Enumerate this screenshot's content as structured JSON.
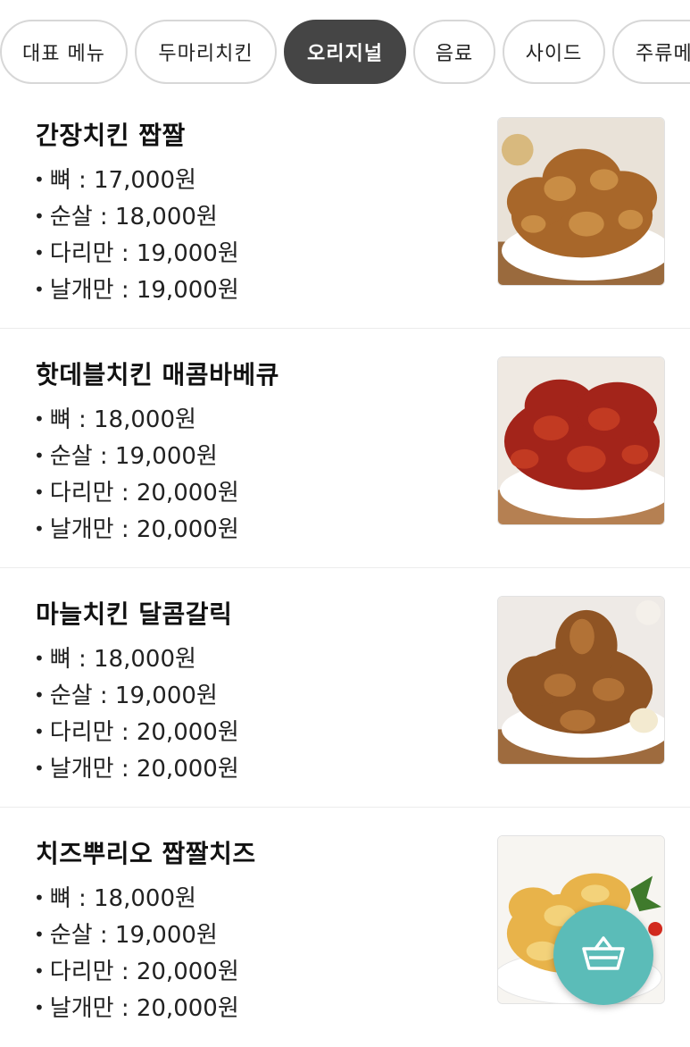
{
  "tabs": [
    {
      "label": "대표 메뉴",
      "active": false
    },
    {
      "label": "두마리치킨",
      "active": false
    },
    {
      "label": "오리지널",
      "active": true
    },
    {
      "label": "음료",
      "active": false
    },
    {
      "label": "사이드",
      "active": false
    },
    {
      "label": "주류메뉴",
      "active": false
    }
  ],
  "menu": [
    {
      "name": "간장치킨 짭짤",
      "prices": [
        "뼈 : 17,000원",
        "순살 : 18,000원",
        "다리만 : 19,000원",
        "날개만 : 19,000원"
      ]
    },
    {
      "name": "핫데블치킨 매콤바베큐",
      "prices": [
        "뼈 : 18,000원",
        "순살 : 19,000원",
        "다리만 : 20,000원",
        "날개만 : 20,000원"
      ]
    },
    {
      "name": "마늘치킨 달콤갈릭",
      "prices": [
        "뼈 : 18,000원",
        "순살 : 19,000원",
        "다리만 : 20,000원",
        "날개만 : 20,000원"
      ]
    },
    {
      "name": "치즈뿌리오 짭짤치즈",
      "prices": [
        "뼈 : 18,000원",
        "순살 : 19,000원",
        "다리만 : 20,000원",
        "날개만 : 20,000원"
      ]
    }
  ],
  "colors": {
    "active_tab": "#454545",
    "fab": "#5bbcb8",
    "border": "#d7d7d7"
  },
  "icons": {
    "cart": "shopping-basket-icon"
  }
}
